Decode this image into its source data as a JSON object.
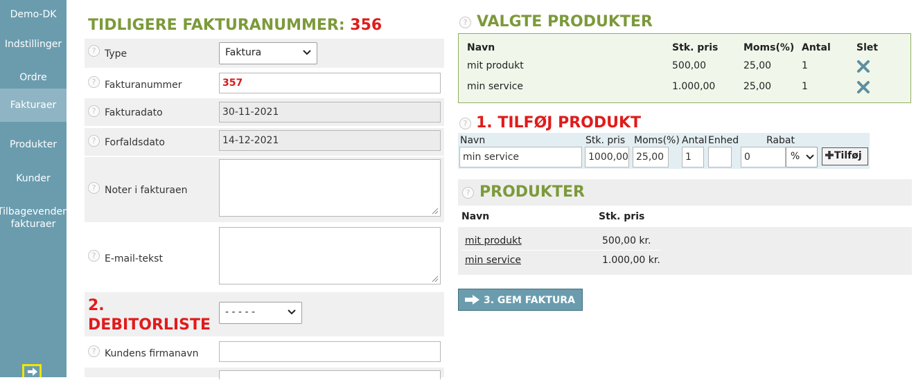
{
  "sidebar": {
    "items": [
      {
        "label": "Demo-DK"
      },
      {
        "label": "Indstillinger"
      },
      {
        "label": "Ordre"
      },
      {
        "label": "Fakturaer"
      },
      {
        "label": "Produkter"
      },
      {
        "label": "Kunder"
      },
      {
        "label": "Tilbagevendende"
      },
      {
        "label": "fakturaer"
      }
    ],
    "active": "Fakturaer"
  },
  "form": {
    "title_prefix": "TIDLIGERE FAKTURANUMMER: ",
    "title_number": "356",
    "help_glyph": "?",
    "type_label": "Type",
    "type_value": "Faktura",
    "invoice_no_label": "Fakturanummer",
    "invoice_no_value": "357",
    "date_label": "Fakturadato",
    "date_value": "30-11-2021",
    "due_label": "Forfaldsdato",
    "due_value": "14-12-2021",
    "notes_label": "Noter i fakturaen",
    "email_label": "E-mail-tekst",
    "debtor_title_line1": "2.",
    "debtor_title_line2": "DEBITORLISTE",
    "debtor_select": "- - - - -",
    "company_label": "Kundens firmanavn"
  },
  "selected": {
    "title": "VALGTE PRODUKTER",
    "headers": {
      "name": "Navn",
      "price": "Stk. pris",
      "vat": "Moms(%)",
      "qty": "Antal",
      "delete": "Slet"
    },
    "rows": [
      {
        "name": "mit produkt",
        "price": "500,00",
        "vat": "25,00",
        "qty": "1"
      },
      {
        "name": "min service",
        "price": "1.000,00",
        "vat": "25,00",
        "qty": "1"
      }
    ]
  },
  "add": {
    "title": "1. TILFØJ PRODUKT",
    "labels": {
      "name": "Navn",
      "price": "Stk. pris",
      "vat": "Moms(%)",
      "qty": "Antal",
      "unit": "Enhed",
      "discount": "Rabat"
    },
    "values": {
      "name": "min service",
      "price": "1000,00",
      "vat": "25,00",
      "qty": "1",
      "unit": "",
      "discount": "0",
      "discount_type": "%"
    },
    "button": "Tilføj"
  },
  "products": {
    "title": "PRODUKTER",
    "headers": {
      "name": "Navn",
      "price": "Stk. pris"
    },
    "rows": [
      {
        "name": "mit produkt",
        "price": "500,00 kr."
      },
      {
        "name": "min service",
        "price": "1.000,00 kr."
      }
    ]
  },
  "save_button": "3. GEM FAKTURA",
  "colors": {
    "sidebar": "#6a9cae",
    "title_green": "#7c9a3a",
    "title_red": "#e01b1b"
  }
}
